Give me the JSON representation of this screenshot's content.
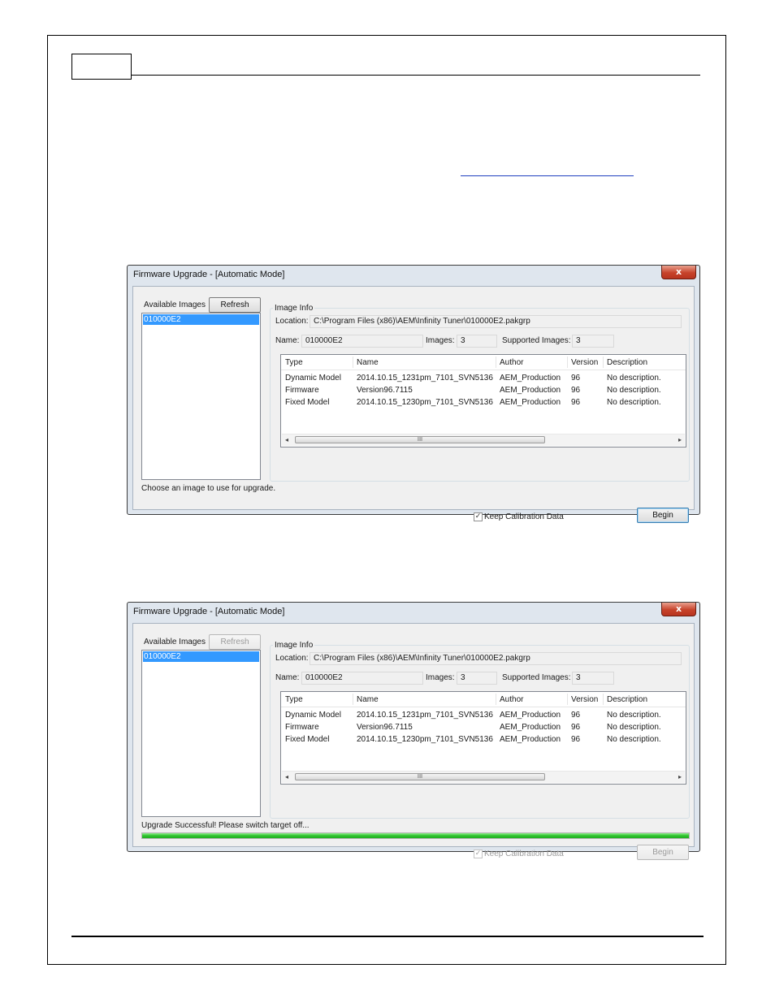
{
  "dialog1": {
    "title": "Firmware Upgrade - [Automatic Mode]",
    "close_label": "x",
    "available_images_label": "Available Images",
    "refresh_label": "Refresh",
    "images": [
      "010000E2"
    ],
    "image_info_label": "Image Info",
    "location_label": "Location:",
    "location_value": "C:\\Program Files (x86)\\AEM\\Infinity Tuner\\010000E2.pakgrp",
    "name_label": "Name:",
    "name_value": "010000E2",
    "images_label": "Images:",
    "images_value": "3",
    "supported_label": "Supported Images:",
    "supported_value": "3",
    "columns": [
      "Type",
      "Name",
      "Author",
      "Version",
      "Description"
    ],
    "rows": [
      [
        "Dynamic Model",
        "2014.10.15_1231pm_7101_SVN5136",
        "AEM_Production",
        "96",
        "No description."
      ],
      [
        "Firmware",
        "Version96.7115",
        "AEM_Production",
        "96",
        "No description."
      ],
      [
        "Fixed Model",
        "2014.10.15_1230pm_7101_SVN5136",
        "AEM_Production",
        "96",
        "No description."
      ]
    ],
    "scroll_grip": "III",
    "status": "Choose an image to use for upgrade.",
    "keep_calibration_label": "Keep Calibration Data",
    "keep_calibration_checked": true,
    "begin_label": "Begin"
  },
  "dialog2": {
    "title": "Firmware Upgrade - [Automatic Mode]",
    "close_label": "x",
    "available_images_label": "Available Images",
    "refresh_label": "Refresh",
    "images": [
      "010000E2"
    ],
    "image_info_label": "Image Info",
    "location_label": "Location:",
    "location_value": "C:\\Program Files (x86)\\AEM\\Infinity Tuner\\010000E2.pakgrp",
    "name_label": "Name:",
    "name_value": "010000E2",
    "images_label": "Images:",
    "images_value": "3",
    "supported_label": "Supported Images:",
    "supported_value": "3",
    "columns": [
      "Type",
      "Name",
      "Author",
      "Version",
      "Description"
    ],
    "rows": [
      [
        "Dynamic Model",
        "2014.10.15_1231pm_7101_SVN5136",
        "AEM_Production",
        "96",
        "No description."
      ],
      [
        "Firmware",
        "Version96.7115",
        "AEM_Production",
        "96",
        "No description."
      ],
      [
        "Fixed Model",
        "2014.10.15_1230pm_7101_SVN5136",
        "AEM_Production",
        "96",
        "No description."
      ]
    ],
    "scroll_grip": "III",
    "status": "Upgrade Successful!  Please switch target off...",
    "progress_fraction": 1.0,
    "keep_calibration_label": "Keep Calibration Data",
    "keep_calibration_checked": true,
    "begin_label": "Begin"
  },
  "colors": {
    "selection": "#3399ff",
    "progress": "#2fc22f",
    "close_button": "#c7432b"
  }
}
